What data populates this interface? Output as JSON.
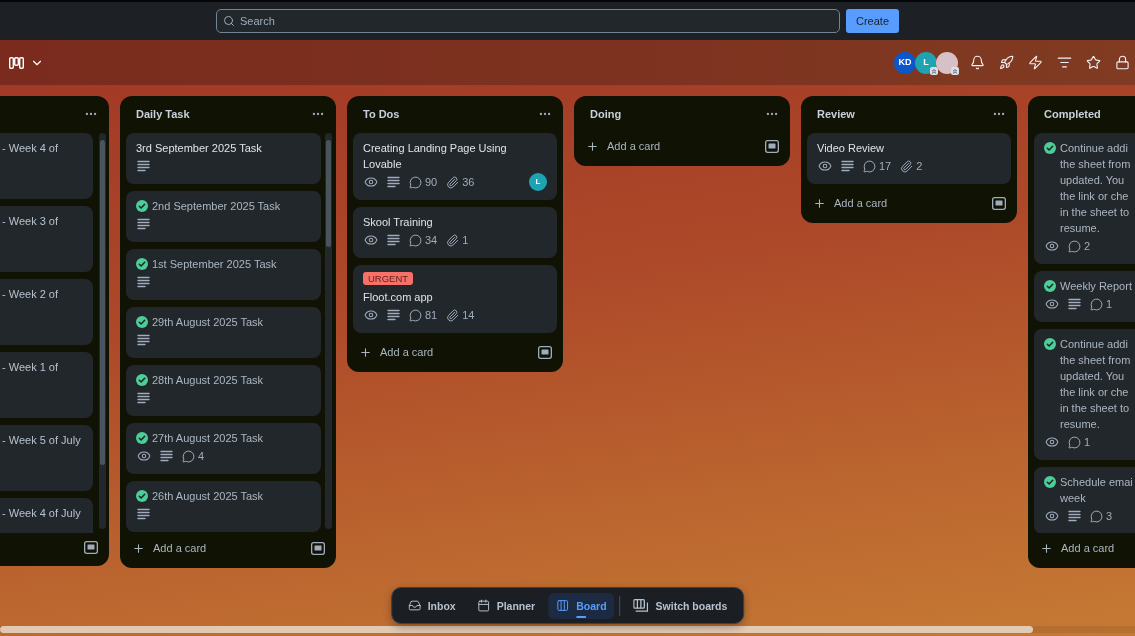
{
  "top_bar": {
    "search": {
      "placeholder": "Search"
    },
    "create_button": "Create"
  },
  "board_header": {
    "members": [
      {
        "kind": "initials",
        "initials": "KD",
        "color": "#0b57c9",
        "badge": false
      },
      {
        "kind": "initials",
        "initials": "L",
        "color": "#1fa3b3",
        "badge": true
      },
      {
        "kind": "photo",
        "badge": true
      }
    ]
  },
  "lists": [
    {
      "scrollbar": true,
      "cards": [
        {
          "title": "- Week 4 of"
        },
        {
          "title": "- Week 3 of"
        },
        {
          "title": "- Week 2 of"
        },
        {
          "title": "- Week 1 of"
        },
        {
          "title": "- Week 5 of July"
        },
        {
          "title": "- Week 4 of July"
        }
      ]
    },
    {
      "title": "Daily Task",
      "scrollbar": true,
      "cards": [
        {
          "title": "3rd September 2025 Task",
          "completed": false,
          "watching": false,
          "description": true
        },
        {
          "title": "2nd September 2025 Task",
          "completed": true,
          "watching": false,
          "description": true
        },
        {
          "title": "1st September 2025 Task",
          "completed": true,
          "watching": false,
          "description": true
        },
        {
          "title": "29th August 2025 Task",
          "completed": true,
          "watching": false,
          "description": true
        },
        {
          "title": "28th August 2025 Task",
          "completed": true,
          "watching": false,
          "description": true
        },
        {
          "title": "27th August 2025 Task",
          "completed": true,
          "watching": true,
          "description": true,
          "comments": "4"
        },
        {
          "title": "26th August 2025 Task",
          "completed": true,
          "watching": false,
          "description": true
        }
      ],
      "add_card": "Add a card"
    },
    {
      "title": "To Dos",
      "scrollbar": false,
      "cards": [
        {
          "title": "Creating Landing Page Using Lovable",
          "completed": false,
          "watching": true,
          "description": true,
          "comments": "90",
          "attachments": "36",
          "members": [
            {
              "kind": "initials",
              "initials": "L",
              "color": "#1fa3b3"
            }
          ]
        },
        {
          "title": "Skool Training",
          "completed": false,
          "watching": true,
          "description": true,
          "comments": "34",
          "attachments": "1"
        },
        {
          "labels": [
            {
              "text": "URGENT",
              "color": "#f87168"
            }
          ],
          "title": "Floot.com app",
          "completed": false,
          "watching": true,
          "description": true,
          "comments": "81",
          "attachments": "14"
        }
      ],
      "add_card": "Add a card"
    },
    {
      "title": "Doing",
      "scrollbar": false,
      "add_card": "Add a card"
    },
    {
      "title": "Review",
      "scrollbar": false,
      "cards": [
        {
          "title": "Video Review",
          "completed": false,
          "watching": true,
          "description": true,
          "comments": "17",
          "attachments": "2"
        }
      ],
      "add_card": "Add a card"
    },
    {
      "title": "Completed",
      "scrollbar": false,
      "cards": [
        {
          "title": "Continue addi\nthe sheet from\nupdated. You\nthe link or che\nin the sheet to\nresume.",
          "completed": true,
          "watching": true,
          "description": false,
          "comments": "2"
        },
        {
          "title": "Weekly Report",
          "completed": true,
          "watching": true,
          "description": true,
          "comments": "1"
        },
        {
          "title": "Continue addi\nthe sheet from\nupdated. You\nthe link or che\nin the sheet to\nresume.",
          "completed": true,
          "watching": true,
          "description": false,
          "comments": "1"
        },
        {
          "title": "Schedule emai\nweek",
          "completed": true,
          "watching": true,
          "description": true,
          "comments": "3"
        }
      ],
      "add_card": "Add a card"
    }
  ],
  "bottom_nav": {
    "tabs": [
      {
        "kind": "inbox",
        "label": "Inbox",
        "selected": false
      },
      {
        "kind": "planner",
        "label": "Planner",
        "selected": false
      },
      {
        "kind": "board",
        "label": "Board",
        "selected": true
      }
    ],
    "switch_boards": "Switch boards"
  }
}
